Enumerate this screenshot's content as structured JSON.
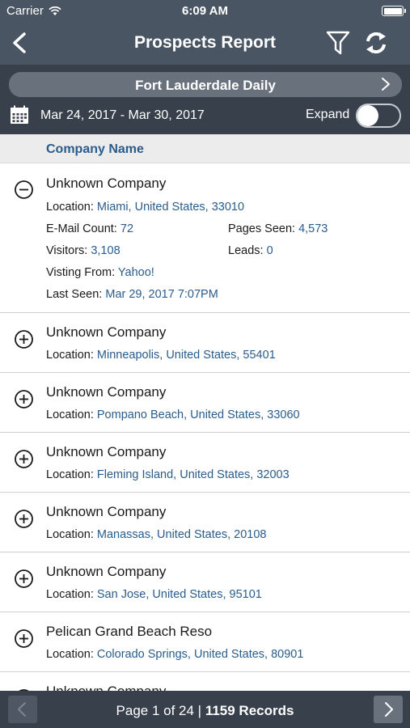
{
  "status_bar": {
    "carrier": "Carrier",
    "time": "6:09 AM"
  },
  "nav": {
    "title": "Prospects Report",
    "back_icon": "chevron-left-icon",
    "filter_icon": "filter-icon",
    "refresh_icon": "refresh-icon"
  },
  "report": {
    "name": "Fort Lauderdale Daily",
    "date_range": "Mar 24, 2017 - Mar 30, 2017",
    "expand_label": "Expand",
    "expand_on": false
  },
  "table": {
    "column_header": "Company Name"
  },
  "labels": {
    "location": "Location: ",
    "email_count": "E-Mail Count: ",
    "pages_seen": "Pages Seen: ",
    "visitors": "Visitors: ",
    "leads": "Leads: ",
    "visiting_from": "Visting From: ",
    "last_seen": "Last Seen: "
  },
  "rows": [
    {
      "name": "Unknown Company",
      "expanded": true,
      "location": "Miami, United States, 33010",
      "email_count": "72",
      "pages_seen": "4,573",
      "visitors": "3,108",
      "leads": "0",
      "visiting_from": "Yahoo!",
      "last_seen": "Mar 29, 2017 7:07PM"
    },
    {
      "name": "Unknown Company",
      "expanded": false,
      "location": "Minneapolis, United States, 55401"
    },
    {
      "name": "Unknown Company",
      "expanded": false,
      "location": "Pompano Beach, United States, 33060"
    },
    {
      "name": "Unknown Company",
      "expanded": false,
      "location": "Fleming Island, United States, 32003"
    },
    {
      "name": "Unknown Company",
      "expanded": false,
      "location": "Manassas, United States, 20108"
    },
    {
      "name": "Unknown Company",
      "expanded": false,
      "location": "San Jose, United States, 95101"
    },
    {
      "name": "Pelican Grand Beach Reso",
      "expanded": false,
      "location": "Colorado Springs, United States, 80901"
    },
    {
      "name": "Unknown Company",
      "expanded": false,
      "location": ""
    }
  ],
  "footer": {
    "page_text": "Page 1 of 24",
    "separator": " | ",
    "records_text": "1159 Records"
  },
  "colors": {
    "nav_bg": "#4a5563",
    "subheader_bg": "#38404b",
    "link_blue": "#2a5c8c"
  }
}
